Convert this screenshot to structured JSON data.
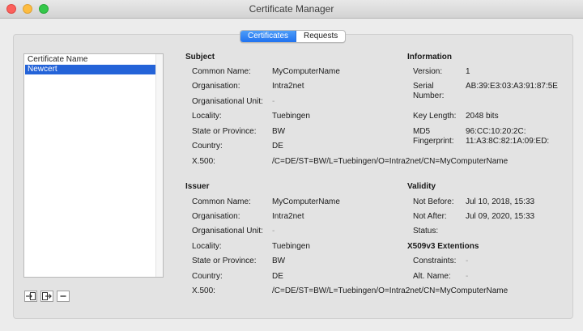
{
  "window": {
    "title": "Certificate Manager"
  },
  "tabs": {
    "certificates": "Certificates",
    "requests": "Requests"
  },
  "list": {
    "header": "Certificate Name",
    "items": [
      "Newcert"
    ]
  },
  "buttons": {
    "import_icon": "import-icon",
    "export_icon": "export-icon",
    "remove_icon": "minus-icon"
  },
  "subject": {
    "title": "Subject",
    "common_name_label": "Common Name:",
    "common_name": "MyComputerName",
    "organisation_label": "Organisation:",
    "organisation": "Intra2net",
    "org_unit_label": "Organisational Unit:",
    "org_unit": "-",
    "locality_label": "Locality:",
    "locality": "Tuebingen",
    "state_label": "State or Province:",
    "state": "BW",
    "country_label": "Country:",
    "country": "DE",
    "x500_label": "X.500:",
    "x500": "/C=DE/ST=BW/L=Tuebingen/O=Intra2net/CN=MyComputerName"
  },
  "issuer": {
    "title": "Issuer",
    "common_name_label": "Common Name:",
    "common_name": "MyComputerName",
    "organisation_label": "Organisation:",
    "organisation": "Intra2net",
    "org_unit_label": "Organisational Unit:",
    "org_unit": "-",
    "locality_label": "Locality:",
    "locality": "Tuebingen",
    "state_label": "State or Province:",
    "state": "BW",
    "country_label": "Country:",
    "country": "DE",
    "x500_label": "X.500:",
    "x500": "/C=DE/ST=BW/L=Tuebingen/O=Intra2net/CN=MyComputerName"
  },
  "information": {
    "title": "Information",
    "version_label": "Version:",
    "version": "1",
    "serial_label_1": "Serial",
    "serial_label_2": "Number:",
    "serial": "AB:39:E3:03:A3:91:87:5E",
    "key_length_label": "Key Length:",
    "key_length": "2048 bits",
    "md5_label_1": "MD5",
    "md5_label_2": "Fingerprint:",
    "md5_1": "96:CC:10:20:2C:",
    "md5_2": "11:A3:8C:82:1A:09:ED:"
  },
  "validity": {
    "title": "Validity",
    "not_before_label": "Not Before:",
    "not_before": "Jul 10, 2018, 15:33",
    "not_after_label": "Not After:",
    "not_after": "Jul 09, 2020, 15:33",
    "status_label": "Status:"
  },
  "extensions": {
    "title": "X509v3 Extentions",
    "constraints_label": "Constraints:",
    "constraints": "-",
    "alt_name_label": "Alt. Name:",
    "alt_name": "-"
  }
}
